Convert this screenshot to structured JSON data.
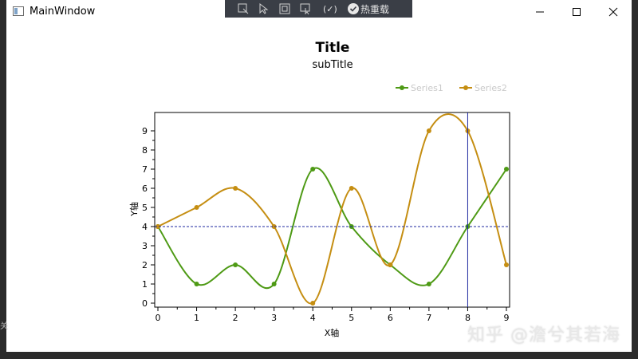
{
  "window": {
    "title": "MainWindow"
  },
  "devtools": {
    "hot_reload_label": "热重载"
  },
  "sidebar_glyph": "关",
  "watermark": "知乎 @澹兮其若海",
  "chart_data": {
    "type": "line",
    "smooth": true,
    "title": "Title",
    "subtitle": "subTitle",
    "xlabel": "X轴",
    "ylabel": "Y轴",
    "xlim": [
      0,
      9
    ],
    "ylim": [
      0,
      9
    ],
    "xticks": [
      0,
      1,
      2,
      3,
      4,
      5,
      6,
      7,
      8,
      9
    ],
    "yticks": [
      0,
      1,
      2,
      3,
      4,
      5,
      6,
      7,
      8,
      9
    ],
    "grid": false,
    "legend_position": "top-right",
    "x": [
      0,
      1,
      2,
      3,
      4,
      5,
      6,
      7,
      8,
      9
    ],
    "series": [
      {
        "name": "Series1",
        "color": "#4e9a15",
        "values": [
          4,
          1,
          2,
          1,
          7,
          4,
          2,
          1,
          4,
          7
        ]
      },
      {
        "name": "Series2",
        "color": "#c58e12",
        "values": [
          4,
          5,
          6,
          4,
          0,
          6,
          2,
          9,
          9,
          2
        ]
      }
    ],
    "crosshair": {
      "x": 8,
      "y": 4,
      "color": "#1f2aa0"
    }
  }
}
